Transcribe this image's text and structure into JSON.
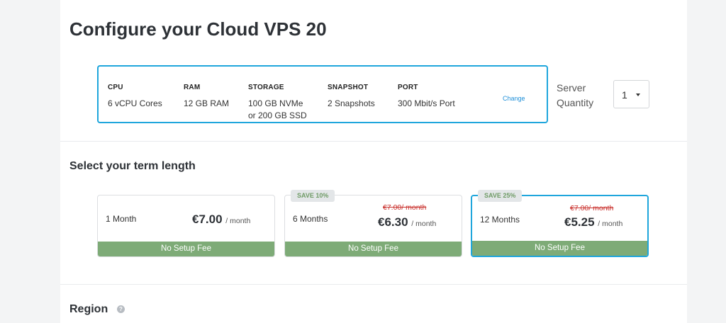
{
  "page": {
    "title": "Configure your Cloud VPS 20"
  },
  "specs": [
    {
      "label": "CPU",
      "value": "6 vCPU Cores"
    },
    {
      "label": "RAM",
      "value": "12 GB RAM"
    },
    {
      "label": "STORAGE",
      "value_line1": "100 GB NVMe",
      "value_line2": "or 200 GB SSD"
    },
    {
      "label": "SNAPSHOT",
      "value": "2 Snapshots"
    },
    {
      "label": "PORT",
      "value": "300 Mbit/s Port"
    }
  ],
  "change_link": "Change",
  "server_quantity": {
    "label_line1": "Server",
    "label_line2": "Quantity",
    "value": "1"
  },
  "term_section": {
    "title": "Select your term length"
  },
  "terms": [
    {
      "months": "1 Month",
      "price": "€7.00",
      "per": "/ month",
      "fee": "No Setup Fee",
      "selected": false
    },
    {
      "badge": "SAVE 10%",
      "months": "6 Months",
      "old_price": "€7.00/ month",
      "price": "€6.30",
      "per": "/ month",
      "fee": "No Setup Fee",
      "selected": false
    },
    {
      "badge": "SAVE 25%",
      "months": "12 Months",
      "old_price": "€7.00/ month",
      "price": "€5.25",
      "per": "/ month",
      "fee": "No Setup Fee",
      "selected": true
    }
  ],
  "region_section": {
    "title": "Region",
    "help_icon": "?"
  },
  "colors": {
    "accent": "#1fa6dc",
    "fee_bar": "#7eab77",
    "strike": "#c9302c",
    "badge_text": "#6f9b66"
  }
}
